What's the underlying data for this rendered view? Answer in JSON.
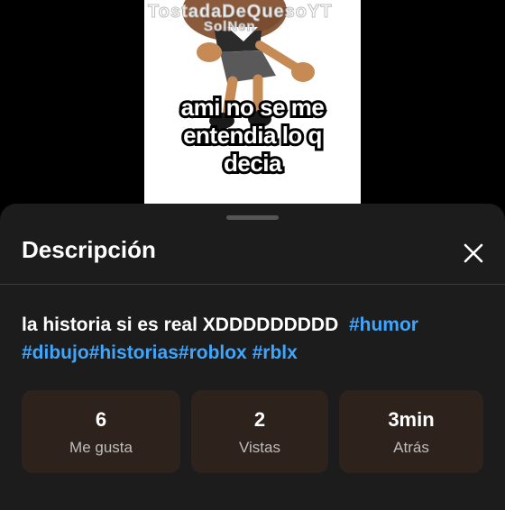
{
  "video": {
    "watermark": "TostadaDeQuesoYT",
    "watermark_sub": "SolNen",
    "caption_lines": [
      "ami no se me",
      "entendia lo q",
      "decia"
    ]
  },
  "sheet": {
    "title": "Descripción",
    "close_icon": "close-icon",
    "description_text": "la historia si es real XDDDDDDDDD",
    "hashtags": [
      "#humor",
      "#dibujo",
      "#historias",
      "#roblox",
      "#rblx"
    ],
    "stats": [
      {
        "value": "6",
        "label": "Me gusta"
      },
      {
        "value": "2",
        "label": "Vistas"
      },
      {
        "value": "3min",
        "label": "Atrás"
      }
    ]
  },
  "colors": {
    "sheet_bg": "#1c1c1c",
    "hashtag": "#3ea6ff",
    "stat_card_bg": "#2e221d"
  }
}
